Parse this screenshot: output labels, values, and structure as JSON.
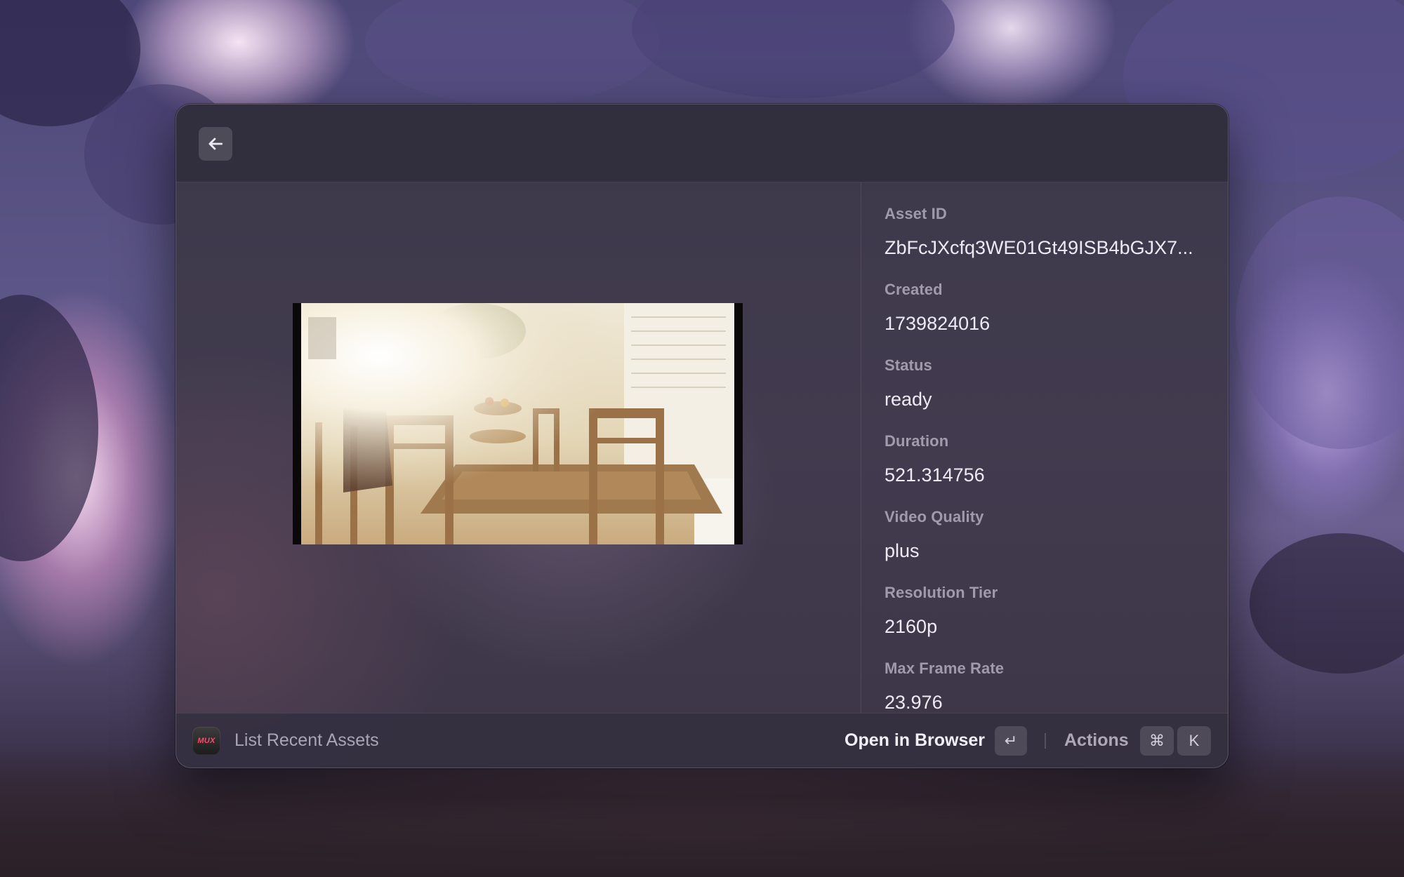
{
  "header": {
    "back_icon": "arrow-left-icon"
  },
  "media": {
    "thumbnail_description": "video-thumbnail"
  },
  "metadata": {
    "items": [
      {
        "label": "Asset ID",
        "value": "ZbFcJXcfq3WE01Gt49ISB4bGJX7..."
      },
      {
        "label": "Created",
        "value": "1739824016"
      },
      {
        "label": "Status",
        "value": "ready"
      },
      {
        "label": "Duration",
        "value": "521.314756"
      },
      {
        "label": "Video Quality",
        "value": "plus"
      },
      {
        "label": "Resolution Tier",
        "value": "2160p"
      },
      {
        "label": "Max Frame Rate",
        "value": "23.976"
      }
    ]
  },
  "footer": {
    "app_icon_text": "MUX",
    "title": "List Recent Assets",
    "primary_action": "Open in Browser",
    "primary_shortcut": "↵",
    "actions_label": "Actions",
    "actions_shortcut_mod": "⌘",
    "actions_shortcut_key": "K"
  },
  "colors": {
    "accent": "#ff4a6a",
    "text_primary": "#eeeaf4",
    "text_secondary": "#a8a1b5"
  }
}
